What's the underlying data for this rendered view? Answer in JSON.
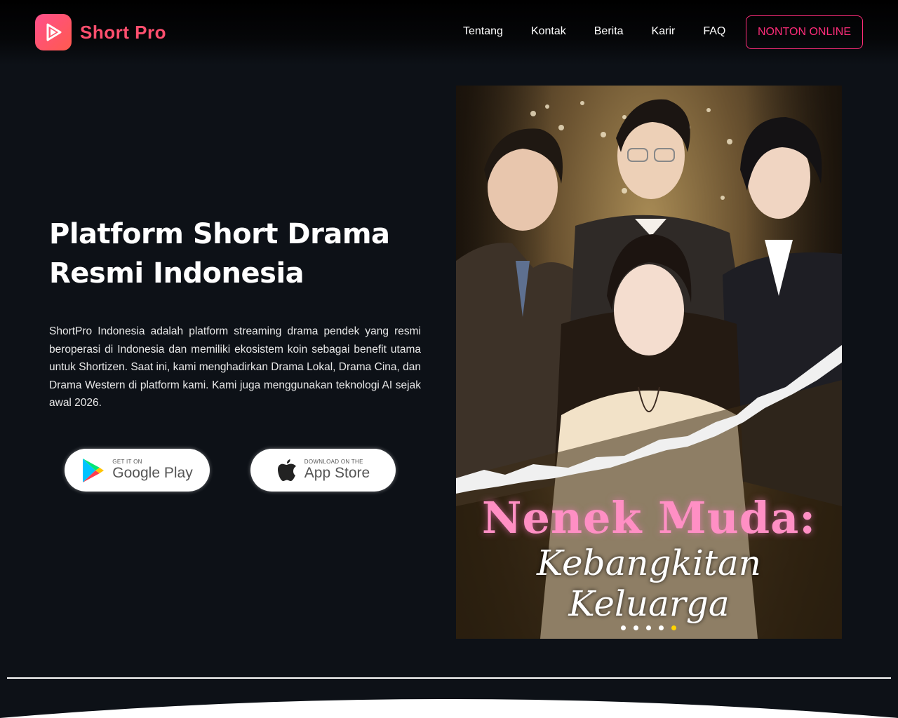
{
  "brand": {
    "name": "Short Pro",
    "accent": "#ff2d7a"
  },
  "nav": {
    "items": [
      "Tentang",
      "Kontak",
      "Berita",
      "Karir",
      "FAQ"
    ],
    "cta": "NONTON ONLINE"
  },
  "hero": {
    "title_line1": "Platform Short Drama",
    "title_line2": "Resmi Indonesia",
    "description": "ShortPro Indonesia adalah platform streaming drama pendek yang resmi beroperasi di Indonesia dan memiliki ekosistem koin sebagai benefit utama untuk Shortizen. Saat ini, kami menghadirkan Drama Lokal, Drama Cina, dan Drama Western di platform kami. Kami juga menggunakan teknologi AI sejak awal 2026."
  },
  "stores": {
    "google": {
      "small": "GET IT ON",
      "big": "Google Play",
      "icon": "google-play-icon"
    },
    "apple": {
      "small": "DOWNLOAD ON THE",
      "big": "App Store",
      "icon": "apple-icon"
    }
  },
  "poster": {
    "title": "Nenek Muda:",
    "subtitle": "Kebangkitan Keluarga",
    "slide_count": 5,
    "active_slide": 5
  }
}
